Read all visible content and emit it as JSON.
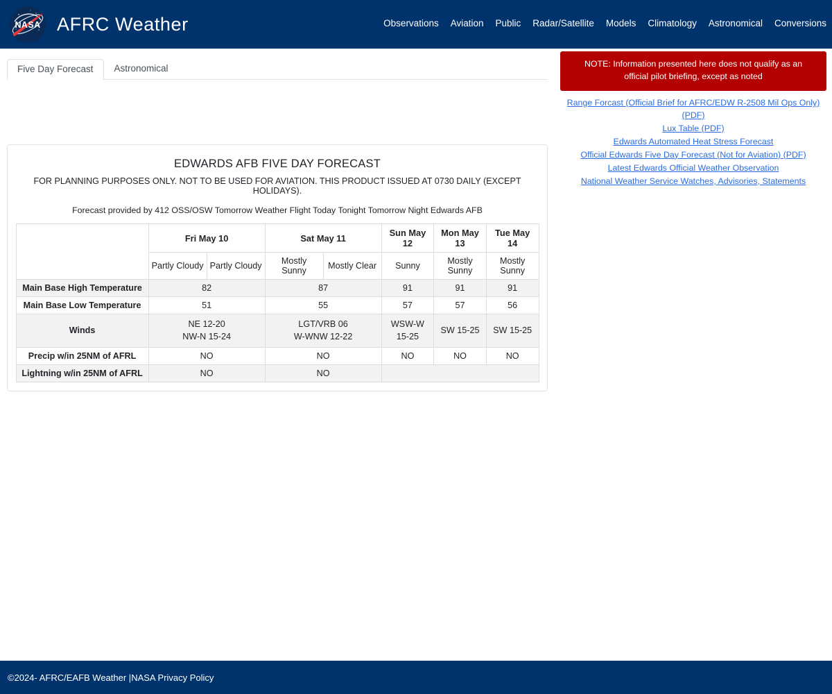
{
  "header": {
    "brand_title": "AFRC Weather",
    "logo_name": "nasa-meatball-logo",
    "nav": [
      {
        "label": "Observations"
      },
      {
        "label": "Aviation"
      },
      {
        "label": "Public"
      },
      {
        "label": "Radar/Satellite"
      },
      {
        "label": "Models"
      },
      {
        "label": "Climatology"
      },
      {
        "label": "Astronomical"
      },
      {
        "label": "Conversions"
      }
    ],
    "bg_color": "#00336b"
  },
  "tabs": [
    {
      "label": "Five Day Forecast",
      "active": true
    },
    {
      "label": "Astronomical",
      "active": false
    }
  ],
  "forecast": {
    "title": "EDWARDS AFB FIVE DAY FORECAST",
    "disclaimer": "FOR PLANNING PURPOSES ONLY. NOT TO BE USED FOR AVIATION. THIS PRODUCT ISSUED AT 0730 DAILY (EXCEPT HOLIDAYS).",
    "provider": "Forecast provided by 412 OSS/OSW Tomorrow Weather Flight Today Tonight Tomorrow Night Edwards AFB",
    "days": [
      {
        "label": "Fri May 10",
        "span": 2
      },
      {
        "label": "Sat May 11",
        "span": 2
      },
      {
        "label": "Sun May 12",
        "span": 1
      },
      {
        "label": "Mon May 13",
        "span": 1
      },
      {
        "label": "Tue May 14",
        "span": 1
      }
    ],
    "conditions": [
      "Partly Cloudy",
      "Partly Cloudy",
      "Mostly Sunny",
      "Mostly Clear",
      "Sunny",
      "Mostly Sunny",
      "Mostly Sunny"
    ],
    "rows": [
      {
        "label": "Main Base High Temperature",
        "cells": [
          {
            "value": "82",
            "span": 2
          },
          {
            "value": "87",
            "span": 2
          },
          {
            "value": "91",
            "span": 1
          },
          {
            "value": "91",
            "span": 1
          },
          {
            "value": "91",
            "span": 1
          }
        ]
      },
      {
        "label": "Main Base Low Temperature",
        "cells": [
          {
            "value": "51",
            "span": 2
          },
          {
            "value": "55",
            "span": 2
          },
          {
            "value": "57",
            "span": 1
          },
          {
            "value": "57",
            "span": 1
          },
          {
            "value": "56",
            "span": 1
          }
        ]
      },
      {
        "label": "Winds",
        "cells": [
          {
            "value": "NE 12-20\nNW-N 15-24",
            "span": 2
          },
          {
            "value": "LGT/VRB 06\nW-WNW 12-22",
            "span": 2
          },
          {
            "value": "WSW-W 15-25",
            "span": 1
          },
          {
            "value": "SW 15-25",
            "span": 1
          },
          {
            "value": "SW 15-25",
            "span": 1
          }
        ]
      },
      {
        "label": "Precip w/in 25NM of AFRL",
        "cells": [
          {
            "value": "NO",
            "span": 2
          },
          {
            "value": "NO",
            "span": 2
          },
          {
            "value": "NO",
            "span": 1
          },
          {
            "value": "NO",
            "span": 1
          },
          {
            "value": "NO",
            "span": 1
          }
        ]
      },
      {
        "label": "Lightning w/in 25NM of AFRL",
        "cells": [
          {
            "value": "NO",
            "span": 2
          },
          {
            "value": "NO",
            "span": 2
          },
          {
            "value": "",
            "span": 3
          }
        ]
      }
    ]
  },
  "side_panel": {
    "note": "NOTE: Information presented here does not qualify as an official pilot briefing, except as noted",
    "note_bg_color": "#b30000",
    "links": [
      {
        "label": "Range Forcast (Official Brief for AFRC/EDW R-2508 Mil Ops Only) (PDF)"
      },
      {
        "label": "Lux Table (PDF)"
      },
      {
        "label": "Edwards Automated Heat Stress Forecast"
      },
      {
        "label": "Official Edwards Five Day Forecast (Not for Aviation) (PDF)"
      },
      {
        "label": "Latest Edwards Official Weather Observation"
      },
      {
        "label": "National Weather Service Watches, Advisories, Statements"
      }
    ],
    "link_color": "#2a6ce0"
  },
  "footer": {
    "copyright": "©2024- AFRC/EAFB Weather |",
    "privacy_link": "NASA Privacy Policy"
  }
}
